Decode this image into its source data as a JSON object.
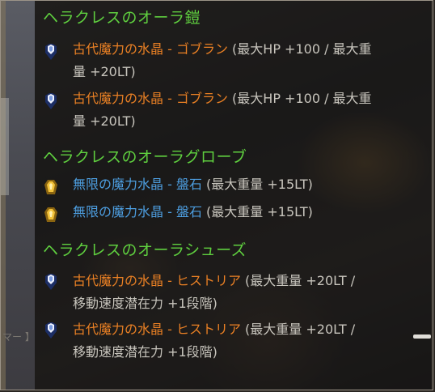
{
  "sections": [
    {
      "title": "ヘラクレスのオーラ鎧",
      "entries": [
        {
          "icon": "ancient-crystal-icon",
          "name": "古代魔力の水晶 - ゴブラン",
          "stats_line1": " (最大HP +100 / 最大重",
          "stats_line2": "量 +20LT)"
        },
        {
          "icon": "ancient-crystal-icon",
          "name": "古代魔力の水晶 - ゴブラン",
          "stats_line1": " (最大HP +100 / 最大重",
          "stats_line2": "量 +20LT)"
        }
      ]
    },
    {
      "title": "ヘラクレスのオーラグローブ",
      "entries": [
        {
          "icon": "infinite-crystal-icon",
          "name": "無限の魔力水晶 - 盤石",
          "stats_line1": " (最大重量 +15LT)"
        },
        {
          "icon": "infinite-crystal-icon",
          "name": "無限の魔力水晶 - 盤石",
          "stats_line1": " (最大重量 +15LT)"
        }
      ]
    },
    {
      "title": "ヘラクレスのオーラシューズ",
      "entries": [
        {
          "icon": "ancient-crystal-icon",
          "name": "古代魔力の水晶 - ヒストリア",
          "stats_line1": " (最大重量 +20LT /",
          "stats_line2": "移動速度潜在力 +1段階)"
        },
        {
          "icon": "ancient-crystal-icon",
          "name": "古代魔力の水晶 - ヒストリア",
          "stats_line1": " (最大重量 +20LT /",
          "stats_line2": "移動速度潜在力 +1段階)"
        }
      ]
    }
  ],
  "background_fragment": "マー 】",
  "colors": {
    "heading": "#5fcf3f",
    "ancient_name": "#ea8024",
    "infinite_name": "#4d9ee0",
    "stats": "#c8c5bd"
  }
}
